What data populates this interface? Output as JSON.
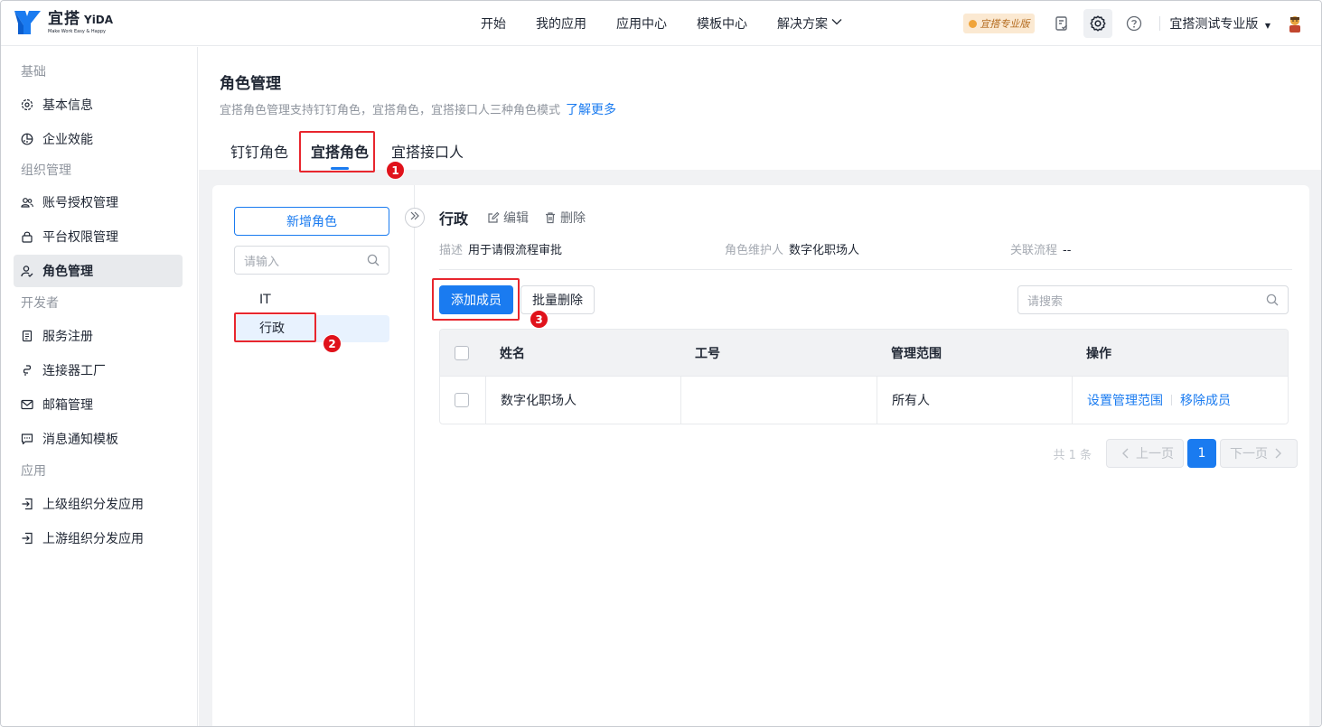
{
  "header": {
    "logo": {
      "title": "宜搭",
      "title_en": "YiDA",
      "slogan": "Make Work Easy & Happy"
    },
    "nav": [
      "开始",
      "我的应用",
      "应用中心",
      "模板中心",
      "解决方案"
    ],
    "pro_badge": "宜搭专业版",
    "org_name": "宜搭测试专业版"
  },
  "sidebar": {
    "groups": [
      {
        "title": "基础",
        "items": [
          {
            "label": "基本信息",
            "icon": "settings-icon"
          },
          {
            "label": "企业效能",
            "icon": "efficiency-icon"
          }
        ]
      },
      {
        "title": "组织管理",
        "items": [
          {
            "label": "账号授权管理",
            "icon": "users-icon"
          },
          {
            "label": "平台权限管理",
            "icon": "lock-icon"
          },
          {
            "label": "角色管理",
            "icon": "user-role-icon",
            "active": true
          }
        ]
      },
      {
        "title": "开发者",
        "items": [
          {
            "label": "服务注册",
            "icon": "document-icon"
          },
          {
            "label": "连接器工厂",
            "icon": "connector-icon"
          },
          {
            "label": "邮箱管理",
            "icon": "mail-icon"
          },
          {
            "label": "消息通知模板",
            "icon": "message-icon"
          }
        ]
      },
      {
        "title": "应用",
        "items": [
          {
            "label": "上级组织分发应用",
            "icon": "login-icon"
          },
          {
            "label": "上游组织分发应用",
            "icon": "login-icon"
          }
        ]
      }
    ]
  },
  "page": {
    "title": "角色管理",
    "desc": "宜搭角色管理支持钉钉角色，宜搭角色，宜搭接口人三种角色模式",
    "learn_more": "了解更多",
    "tabs": [
      "钉钉角色",
      "宜搭角色",
      "宜搭接口人"
    ],
    "active_tab": 1
  },
  "role_panel": {
    "add_role": "新增角色",
    "search_placeholder": "请输入",
    "roles": [
      "IT",
      "行政"
    ],
    "active_role": 1
  },
  "detail": {
    "role_name": "行政",
    "edit": "编辑",
    "delete": "删除",
    "desc_label": "描述",
    "desc_value": "用于请假流程审批",
    "maintainer_label": "角色维护人",
    "maintainer_value": "数字化职场人",
    "flow_label": "关联流程",
    "flow_value": "--",
    "add_member": "添加成员",
    "batch_delete": "批量删除",
    "search_placeholder": "请搜索"
  },
  "table": {
    "columns": [
      "姓名",
      "工号",
      "管理范围",
      "操作"
    ],
    "rows": [
      {
        "name": "数字化职场人",
        "id": "",
        "scope": "所有人",
        "op1": "设置管理范围",
        "op2": "移除成员"
      }
    ]
  },
  "pager": {
    "total": "共 1 条",
    "prev": "上一页",
    "next": "下一页",
    "current": "1"
  },
  "annotations": [
    "1",
    "2",
    "3"
  ],
  "colors": {
    "primary": "#1a7bf0",
    "annotation": "#e8262e"
  }
}
